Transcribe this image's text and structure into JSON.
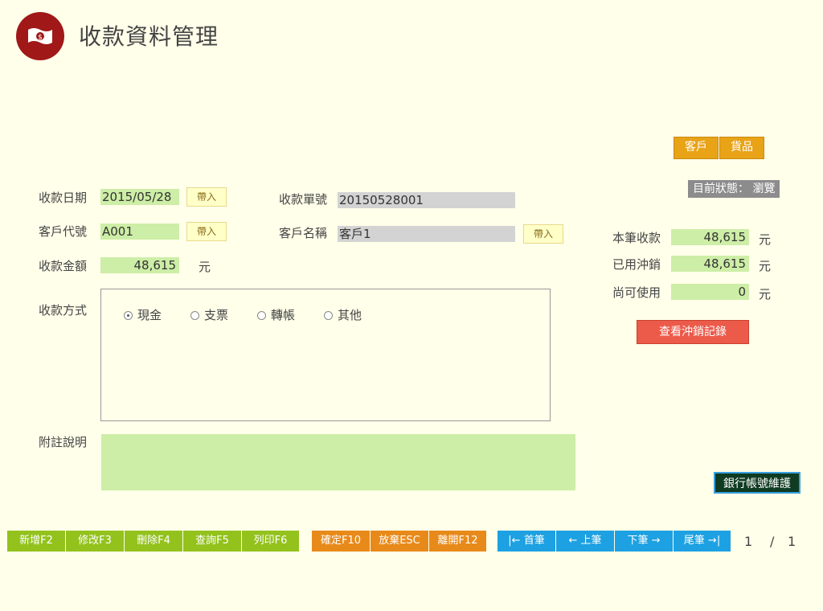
{
  "header": {
    "title": "收款資料管理",
    "logo_icon": "money-icon"
  },
  "top_buttons": {
    "customer": "客戶",
    "goods": "貨品"
  },
  "status": {
    "text": "目前狀態： 瀏覽"
  },
  "form": {
    "date_label": "收款日期",
    "date_value": "2015/05/28",
    "bring_label": "帶入",
    "doc_no_label": "收款單號",
    "doc_no_value": "20150528001",
    "cust_code_label": "客戶代號",
    "cust_code_value": "A001",
    "cust_name_label": "客戶名稱",
    "cust_name_value": "客戶1",
    "amount_label": "收款金額",
    "amount_value": "48,615",
    "unit": "元",
    "method_label": "收款方式",
    "methods": [
      "現金",
      "支票",
      "轉帳",
      "其他"
    ],
    "method_selected": "現金",
    "note_label": "附註說明",
    "note_value": ""
  },
  "summary": {
    "this_label": "本筆收款",
    "this_value": "48,615",
    "used_label": "已用沖銷",
    "used_value": "48,615",
    "remain_label": "尚可使用",
    "remain_value": "0",
    "unit": "元",
    "view_button": "查看沖銷記錄"
  },
  "bank_button": "銀行帳號維護",
  "toolbar": {
    "add": "新增F2",
    "edit": "修改F3",
    "delete": "刪除F4",
    "query": "查詢F5",
    "print": "列印F6",
    "confirm": "確定F10",
    "cancel": "放棄ESC",
    "exit": "離開F12",
    "first": "|← 首筆",
    "prev": "← 上筆",
    "next": "下筆 →",
    "last": "尾筆 →|"
  },
  "pager": {
    "current": "1",
    "separator": "/",
    "total": "1"
  },
  "colors": {
    "background": "#ffffea",
    "logo": "#a01818",
    "field_green": "#cdeea6",
    "orange": "#e8a317",
    "red": "#ec5a4a",
    "toolbar_green": "#93c21d",
    "toolbar_orange": "#e88a1a",
    "toolbar_blue": "#1da1e2"
  }
}
